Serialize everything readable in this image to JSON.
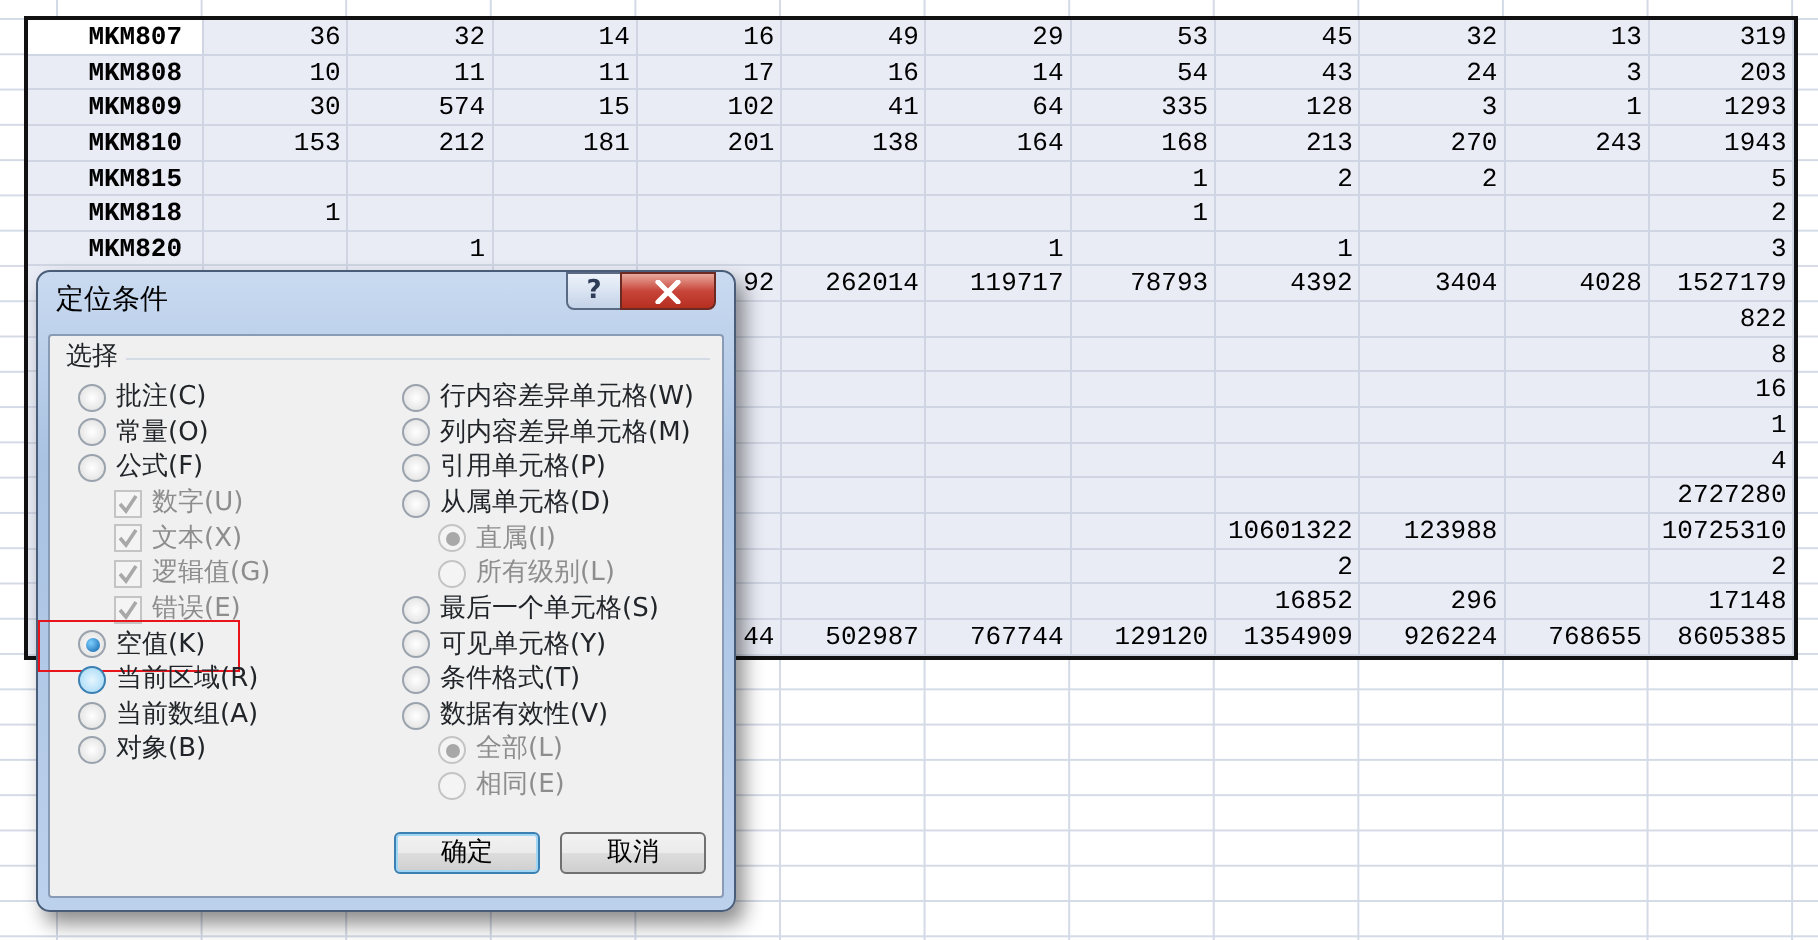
{
  "sheet": {
    "rows": [
      {
        "label_selected": true,
        "column_1": "MKM807",
        "column_2": "36",
        "column_3": "32",
        "column_4": "14",
        "column_5": "16",
        "column_6": "49",
        "column_7": "29",
        "column_8": "53",
        "column_9": "45",
        "column_10": "32",
        "column_11": "13",
        "column_12": "319"
      },
      {
        "label_selected": false,
        "column_1": "MKM808",
        "column_2": "10",
        "column_3": "11",
        "column_4": "11",
        "column_5": "17",
        "column_6": "16",
        "column_7": "14",
        "column_8": "54",
        "column_9": "43",
        "column_10": "24",
        "column_11": "3",
        "column_12": "203"
      },
      {
        "label_selected": false,
        "column_1": "MKM809",
        "column_2": "30",
        "column_3": "574",
        "column_4": "15",
        "column_5": "102",
        "column_6": "41",
        "column_7": "64",
        "column_8": "335",
        "column_9": "128",
        "column_10": "3",
        "column_11": "1",
        "column_12": "1293"
      },
      {
        "label_selected": false,
        "column_1": "MKM810",
        "column_2": "153",
        "column_3": "212",
        "column_4": "181",
        "column_5": "201",
        "column_6": "138",
        "column_7": "164",
        "column_8": "168",
        "column_9": "213",
        "column_10": "270",
        "column_11": "243",
        "column_12": "1943"
      },
      {
        "label_selected": false,
        "column_1": "MKM815",
        "column_8": "1",
        "column_9": "2",
        "column_10": "2",
        "column_12": "5"
      },
      {
        "label_selected": false,
        "column_1": "MKM818",
        "column_2": "1",
        "column_8": "1",
        "column_12": "2"
      },
      {
        "label_selected": false,
        "column_1": "MKM820",
        "column_3": "1",
        "column_7": "1",
        "column_9": "1",
        "column_12": "3"
      },
      {
        "column_5": "92",
        "column_6": "262014",
        "column_7": "119717",
        "column_8": "78793",
        "column_9": "4392",
        "column_10": "3404",
        "column_11": "4028",
        "column_12": "1527179"
      },
      {
        "column_12": "822"
      },
      {
        "column_12": "8"
      },
      {
        "column_12": "16"
      },
      {
        "column_12": "1"
      },
      {
        "column_12": "4"
      },
      {
        "column_12": "2727280"
      },
      {
        "column_9": "10601322",
        "column_10": "123988",
        "column_12": "10725310"
      },
      {
        "column_9": "2",
        "column_12": "2"
      },
      {
        "column_9": "16852",
        "column_10": "296",
        "column_12": "17148"
      },
      {
        "column_5": "44",
        "column_6": "502987",
        "column_7": "767744",
        "column_8": "129120",
        "column_9": "1354909",
        "column_10": "926224",
        "column_11": "768655",
        "column_12": "8605385"
      }
    ]
  },
  "dialog": {
    "title": "定位条件",
    "help_button": "?",
    "group_label": "选择",
    "left_options": [
      {
        "kind": "radio",
        "label": "批注(C)",
        "selected": false,
        "disabled": false
      },
      {
        "kind": "radio",
        "label": "常量(O)",
        "selected": false,
        "disabled": false
      },
      {
        "kind": "radio",
        "label": "公式(F)",
        "selected": false,
        "disabled": false,
        "children": [
          {
            "kind": "checkbox",
            "label": "数字(U)",
            "checked": true,
            "disabled": true
          },
          {
            "kind": "checkbox",
            "label": "文本(X)",
            "checked": true,
            "disabled": true
          },
          {
            "kind": "checkbox",
            "label": "逻辑值(G)",
            "checked": true,
            "disabled": true
          },
          {
            "kind": "checkbox",
            "label": "错误(E)",
            "checked": true,
            "disabled": true
          }
        ]
      },
      {
        "kind": "radio",
        "label": "空值(K)",
        "selected": true,
        "disabled": false,
        "highlighted": true
      },
      {
        "kind": "radio",
        "label": "当前区域(R)",
        "selected": false,
        "disabled": false,
        "hovered": true
      },
      {
        "kind": "radio",
        "label": "当前数组(A)",
        "selected": false,
        "disabled": false
      },
      {
        "kind": "radio",
        "label": "对象(B)",
        "selected": false,
        "disabled": false
      }
    ],
    "right_options": [
      {
        "kind": "radio",
        "label": "行内容差异单元格(W)",
        "selected": false,
        "disabled": false
      },
      {
        "kind": "radio",
        "label": "列内容差异单元格(M)",
        "selected": false,
        "disabled": false
      },
      {
        "kind": "radio",
        "label": "引用单元格(P)",
        "selected": false,
        "disabled": false
      },
      {
        "kind": "radio",
        "label": "从属单元格(D)",
        "selected": false,
        "disabled": false,
        "children": [
          {
            "kind": "radio",
            "label": "直属(I)",
            "selected": true,
            "disabled": true
          },
          {
            "kind": "radio",
            "label": "所有级别(L)",
            "selected": false,
            "disabled": true
          }
        ]
      },
      {
        "kind": "radio",
        "label": "最后一个单元格(S)",
        "selected": false,
        "disabled": false
      },
      {
        "kind": "radio",
        "label": "可见单元格(Y)",
        "selected": false,
        "disabled": false
      },
      {
        "kind": "radio",
        "label": "条件格式(T)",
        "selected": false,
        "disabled": false
      },
      {
        "kind": "radio",
        "label": "数据有效性(V)",
        "selected": false,
        "disabled": false,
        "children": [
          {
            "kind": "radio",
            "label": "全部(L)",
            "selected": true,
            "disabled": true
          },
          {
            "kind": "radio",
            "label": "相同(E)",
            "selected": false,
            "disabled": true
          }
        ]
      }
    ],
    "buttons": [
      {
        "label": "确定",
        "default": true
      },
      {
        "label": "取消",
        "default": false
      }
    ]
  }
}
